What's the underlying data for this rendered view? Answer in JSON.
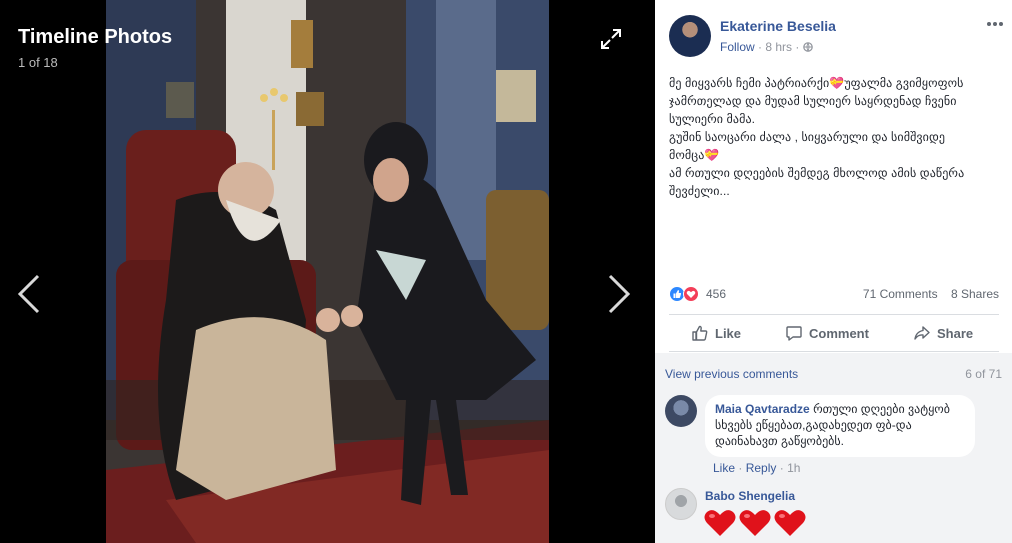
{
  "viewer": {
    "title": "Timeline Photos",
    "count": "1 of 18",
    "expand_icon": "expand-icon",
    "prev_icon": "chevron-left-icon",
    "next_icon": "chevron-right-icon"
  },
  "post": {
    "author": "Ekaterine Beselia",
    "follow": "Follow",
    "time": "8 hrs",
    "privacy_icon": "globe-icon",
    "text_lines": [
      "მე მიყვარს ჩემი პატრიარქი💝უფალმა გვიმყოფოს",
      "ჯამრთელად და მუდამ სულიერ საყრდენად ჩვენი",
      "სულიერი მამა.",
      "გუშინ საოცარი ძალა , სიყვარული და სიმშვიდე",
      "მომცა💝",
      "ამ რთული დღეების შემდეგ მხოლოდ ამის დაწერა",
      "შევძელი..."
    ]
  },
  "reactions": {
    "icons": [
      "like-reaction-icon",
      "love-reaction-icon"
    ],
    "count": "456",
    "comments": "71 Comments",
    "shares": "8 Shares"
  },
  "actions": {
    "like": "Like",
    "comment": "Comment",
    "share": "Share"
  },
  "comments": {
    "view_previous": "View previous comments",
    "count": "6 of 71",
    "items": [
      {
        "name": "Maia Qavtaradze",
        "text": "რთული დღეები ვატყობ სხვებს ეწყებათ,გადახედეთ ფბ-და დაინახავთ გაწყობებს.",
        "like": "Like",
        "reply": "Reply",
        "time": "1h"
      },
      {
        "name": "Babo Shengelia",
        "content_icons": [
          "heart-emoji-icon",
          "heart-emoji-icon",
          "heart-emoji-icon"
        ]
      }
    ]
  },
  "colors": {
    "link": "#385898",
    "meta": "#90949c",
    "comments_bg": "#f2f3f5",
    "like_blue": "#2d88ff",
    "love_red": "#f33e58"
  }
}
